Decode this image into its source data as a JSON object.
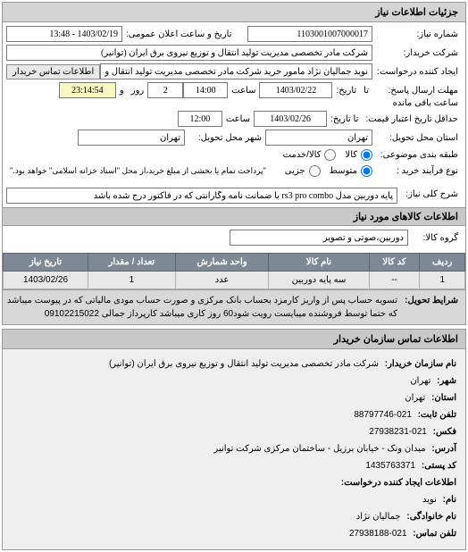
{
  "panel_title": "جزئیات اطلاعات نیاز",
  "fields": {
    "need_number_label": "شماره نیاز:",
    "need_number": "1103001007000017",
    "announce_label": "تاریخ و ساعت اعلان عمومی:",
    "announce_value": "1403/02/19 - 13:48",
    "buyer_org_label": "شرکت خریدار:",
    "buyer_org": "شرکت مادر تخصصی مدیریت تولید انتقال و توزیع نیروی برق ایران (توانیر)",
    "requester_label": "ایجاد کننده درخواست:",
    "requester": "نوید جمالیان نژاد مامور خرید شرکت مادر تخصصی مدیریت تولید انتقال و توزیع نیر",
    "contact_btn": "اطلاعات تماس خریدار",
    "response_deadline_label": "مهلت ارسال پاسخ:",
    "to_label": "تا",
    "date_label": "تاریخ:",
    "time_label": "ساعت",
    "and_label": "و",
    "day_label": "روز",
    "remaining_label": "ساعت باقی مانده",
    "response_date": "1403/02/22",
    "response_time": "14:00",
    "remaining_days": "2",
    "remaining_time": "23:14:54",
    "validity_label": "حداقل تاریخ اعتبار قیمت:",
    "validity_to_label": "تا تاریخ:",
    "validity_date": "1403/02/26",
    "validity_time": "12:00",
    "province_label": "استان محل تحویل:",
    "province": "تهران",
    "city_label": "شهر محل تحویل:",
    "city": "تهران",
    "grouping_label": "طبقه بندی موضوعی:",
    "goods_radio": "کالا",
    "service_radio": "کالا/خدمت",
    "process_type_label": "نوع فرآیند خرید :",
    "medium_radio": "متوسط",
    "small_radio": "جزیی",
    "process_note": "\"پرداخت تمام یا بخشی از مبلغ خرید،از محل \"اسناد خزانه اسلامی\" خواهد بود.\"",
    "general_desc_label": "شرح کلی نیاز:",
    "general_desc": "پایه دوربین مدل rs3 pro combo با ضمانت نامه وگارانتی که در فاکتور درج شده باشد"
  },
  "items_section_title": "اطلاعات کالاهای مورد نیاز",
  "group_label": "گروه کالا:",
  "group_value": "دوربین،صوتی و تصویر",
  "table": {
    "headers": [
      "ردیف",
      "کد کالا",
      "نام کالا",
      "واحد شمارش",
      "تعداد / مقدار",
      "تاریخ نیاز"
    ],
    "rows": [
      {
        "row": "1",
        "code": "--",
        "name": "سه پایه دوربین",
        "unit": "عدد",
        "qty": "1",
        "date": "1403/02/26"
      }
    ]
  },
  "settlement_label": "شرایط تحویل:",
  "settlement_text": "تسویه حساب پس از واریز کارمزد بحساب بانک مرکزی و صورت حساب مودی مالیاتی که در پیوست میباشد که حتما توسط فروشنده میبایست رویت شود60 روز کاری میباشد کارپرداز جمالی 09102215022",
  "contact_panel": {
    "title": "اطلاعات تماس سازمان خریدار",
    "org_name_label": "نام سازمان خریدار:",
    "org_name": "شرکت مادر تخصصی مدیریت تولید انتقال و توزیع نیروی برق ایران (توانیر)",
    "city_label": "شهر:",
    "city": "تهران",
    "province_label": "استان:",
    "province": "تهران",
    "phone_label": "تلفن ثابت:",
    "phone": "021-88797746",
    "fax_label": "فکس:",
    "fax": "021-27938231",
    "address_label": "آدرس:",
    "address": "میدان ونک - خیابان برزیل - ساختمان مرکزی شرکت توانیر",
    "postal_label": "کد پستی:",
    "postal": "1435763371",
    "creator_section": "اطلاعات ایجاد کننده درخواست:",
    "name_label": "نام:",
    "name": "نوید",
    "lastname_label": "نام خانوادگی:",
    "lastname": "جمالیان نژاد",
    "contact_phone_label": "تلفن تماس:",
    "contact_phone": "021-27938188"
  }
}
